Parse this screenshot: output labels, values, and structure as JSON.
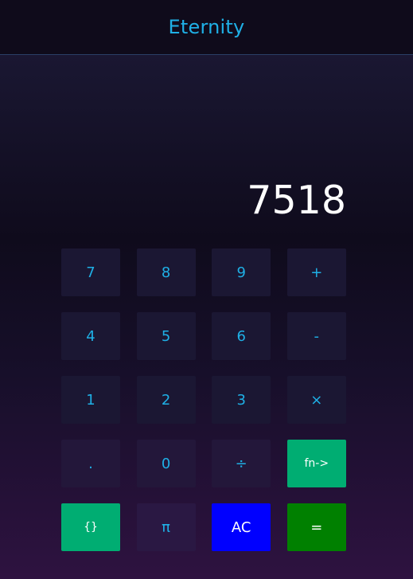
{
  "app": {
    "title": "Eternity"
  },
  "display": {
    "value": "7518"
  },
  "keypad": {
    "rows": [
      [
        "7",
        "8",
        "9",
        "+"
      ],
      [
        "4",
        "5",
        "6",
        "-"
      ],
      [
        "1",
        "2",
        "3",
        "×"
      ],
      [
        ".",
        "0",
        "÷",
        "fn->"
      ],
      [
        "{}",
        "π",
        "AC",
        "="
      ]
    ]
  },
  "colors": {
    "accent": "#1fb0e6",
    "key_background": "#1b1733",
    "fn_key": "#00ad72",
    "braces_key": "#00ad72",
    "clear_key": "#0000ff",
    "equals_key": "#008000"
  }
}
